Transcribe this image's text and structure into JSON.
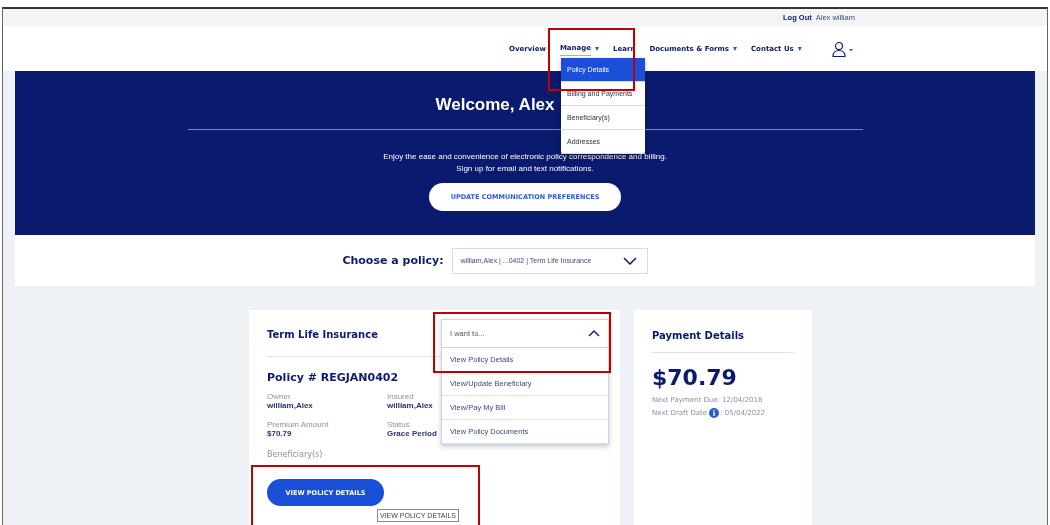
{
  "top_bar": {
    "logout": "Log Out",
    "user": "Alex william"
  },
  "nav": {
    "items": [
      {
        "label": "Overview",
        "selected": false
      },
      {
        "label": "Manage",
        "caret": "▾",
        "selected": true
      },
      {
        "label": "Learn",
        "selected": false
      },
      {
        "label": "Documents & Forms",
        "caret": "▾",
        "selected": false
      },
      {
        "label": "Contact Us",
        "caret": "▾",
        "selected": false
      }
    ],
    "manage_menu": [
      {
        "label": "Policy Details",
        "selected": true
      },
      {
        "label": "Billing and Payments",
        "selected": false
      },
      {
        "label": "Beneficiary(s)",
        "selected": false
      },
      {
        "label": "Addresses",
        "selected": false
      }
    ]
  },
  "hero": {
    "title": "Welcome, Alex",
    "lines": [
      "Enjoy the ease and convenience of electronic policy correspondence and billing.",
      "Sign up for email and text notifications."
    ],
    "button": "UPDATE COMMUNICATION PREFERENCES"
  },
  "policy_chooser": {
    "label": "Choose a policy:",
    "value": "william,Alex | ...0402 | Term Life Insurance"
  },
  "policy_card": {
    "title": "Term Life Insurance",
    "action_select": {
      "placeholder": "I want to...",
      "expanded": true,
      "options": [
        {
          "label": "View Policy Details"
        },
        {
          "label": "View/Update Beneficiary"
        },
        {
          "label": "View/Pay My Bill"
        },
        {
          "label": "View Policy Documents"
        }
      ]
    },
    "policy_number": "Policy # REGJAN0402",
    "fields": [
      {
        "label": "Owner",
        "value": "william,Alex"
      },
      {
        "label": "Insured",
        "value": "william,Alex"
      },
      {
        "label": "Premium Amount",
        "value": "$70.79"
      },
      {
        "label": "Status",
        "value": "Grace Period"
      }
    ],
    "beneficiary_label": "Beneficiary(s)",
    "button": "VIEW POLICY DETAILS",
    "tooltip": "VIEW POLICY DETAILS"
  },
  "payment_card": {
    "title": "Payment Details",
    "amount": "$70.79",
    "next_due": "Next Payment Due: 12/04/2018",
    "draft_label": "Next Draft Date",
    "draft_value": ": 05/04/2022"
  }
}
